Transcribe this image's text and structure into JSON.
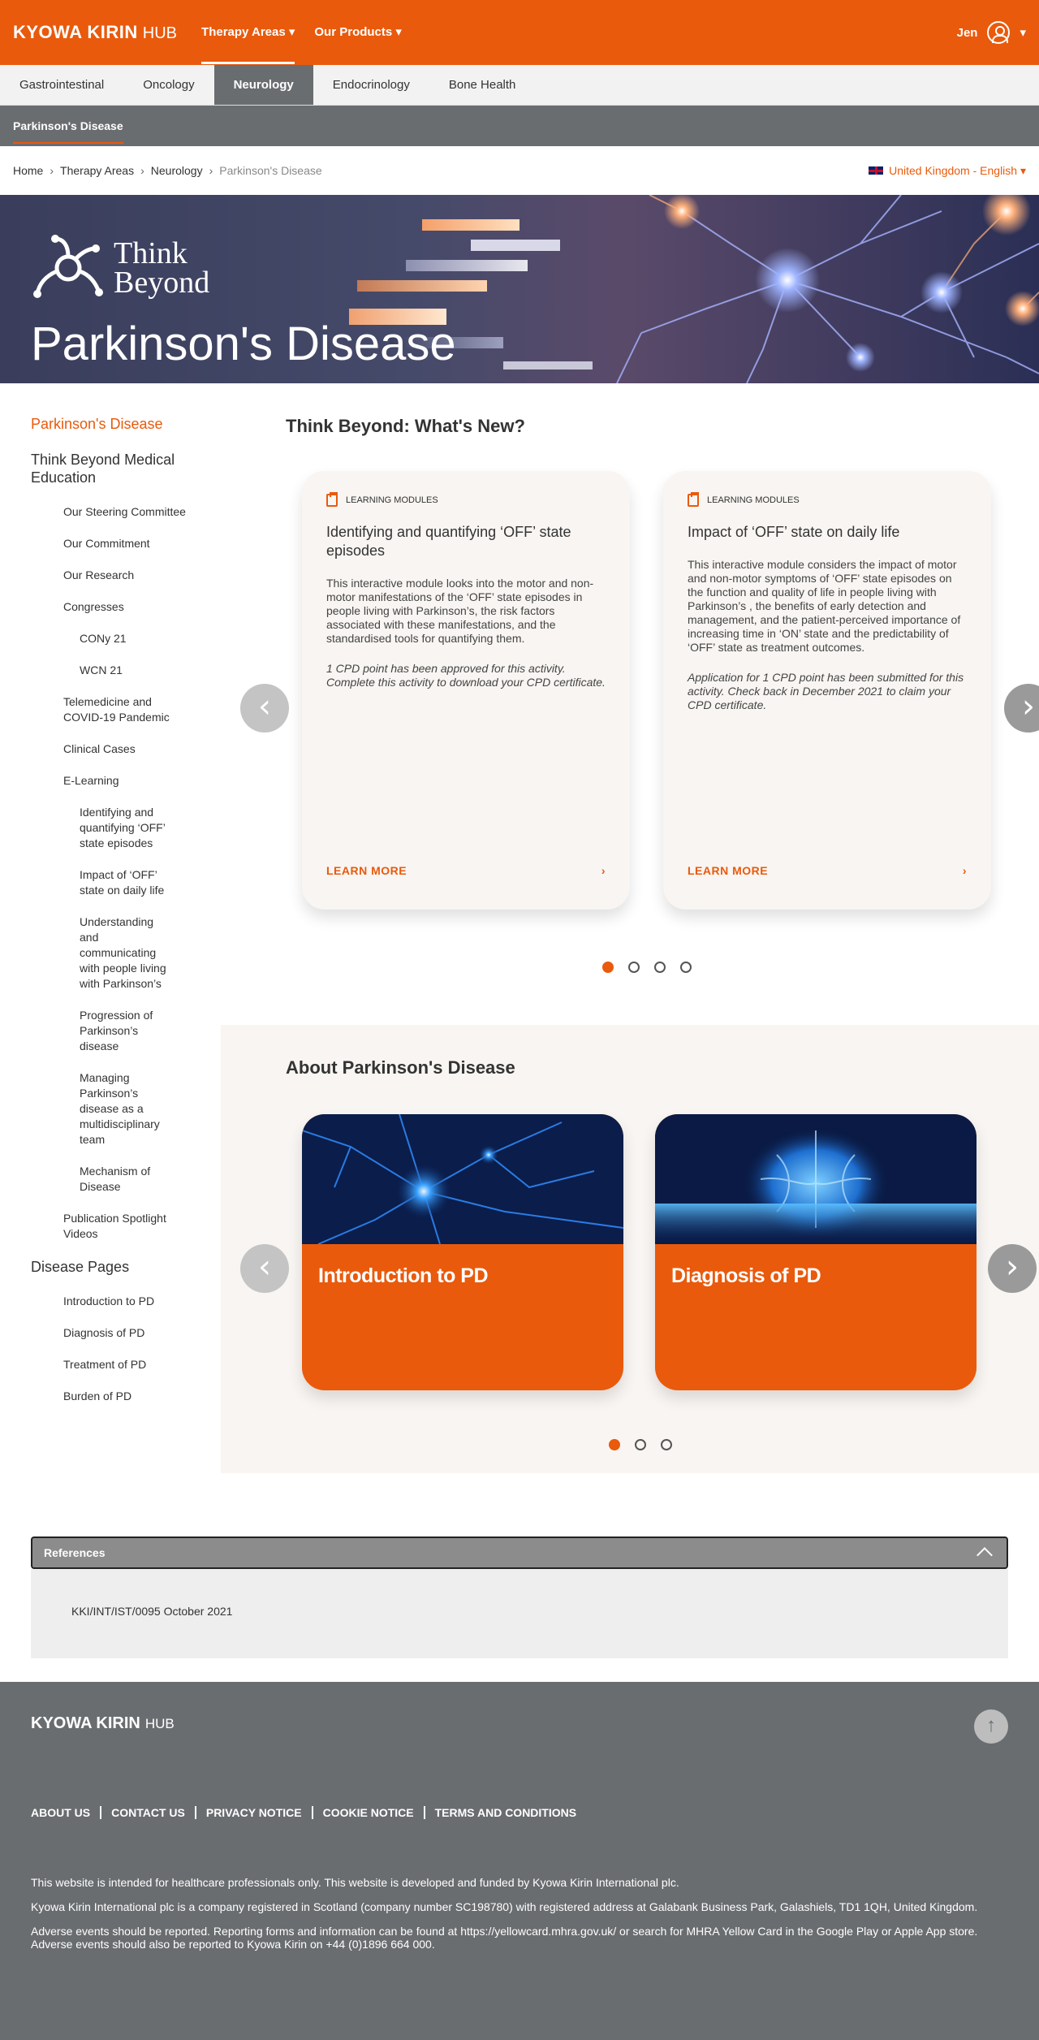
{
  "header": {
    "brand": "KYOWA KIRIN",
    "hub": "HUB",
    "nav": [
      "Therapy Areas ▾",
      "Our Products ▾"
    ],
    "user": "Jen",
    "user_caret": "▾"
  },
  "tabs": [
    "Gastrointestinal",
    "Oncology",
    "Neurology",
    "Endocrinology",
    "Bone Health"
  ],
  "subnav": "Parkinson's Disease",
  "breadcrumb": [
    "Home",
    "Therapy Areas",
    "Neurology",
    "Parkinson's Disease"
  ],
  "breadcrumb_sep": "›",
  "language": "United Kingdom - English ▾",
  "hero": {
    "think_line1": "Think",
    "think_line2": "Beyond",
    "title": "Parkinson's Disease"
  },
  "sidebar": {
    "top": "Parkinson's Disease",
    "heading1": "Think Beyond Medical Education",
    "items1": [
      "Our Steering Committee",
      "Our Commitment",
      "Our Research",
      "Congresses"
    ],
    "congresses": [
      "CONy 21",
      "WCN 21"
    ],
    "items2": [
      "Telemedicine and COVID-19 Pandemic",
      "Clinical Cases",
      "E-Learning"
    ],
    "elearning": [
      "Identifying and quantifying ‘OFF’ state episodes",
      "Impact of ‘OFF’ state on daily life",
      "Understanding and communicating with people living with Parkinson’s",
      "Progression of Parkinson’s disease",
      "Managing Parkinson’s disease as a multidisciplinary team",
      "Mechanism of Disease"
    ],
    "items3": [
      "Publication Spotlight Videos"
    ],
    "heading2": "Disease Pages",
    "disease_pages": [
      "Introduction to PD",
      "Diagnosis of PD",
      "Treatment of PD",
      "Burden of PD"
    ]
  },
  "whats_new": {
    "title": "Think Beyond: What's New?",
    "cards": [
      {
        "tag": "LEARNING MODULES",
        "title": "Identifying and quantifying ‘OFF’ state episodes",
        "body": "This interactive module looks into the motor and non-motor manifestations of the ‘OFF’ state episodes in people living with Parkinson’s, the risk factors associated with these manifestations, and the standardised tools for quantifying them.",
        "note": "1 CPD point has been approved for this activity. Complete this activity to download your CPD certificate.",
        "cta": "LEARN MORE"
      },
      {
        "tag": "LEARNING MODULES",
        "title": "Impact of ‘OFF’ state on daily life",
        "body": "This interactive module considers the impact of motor and non-motor symptoms of ‘OFF’ state episodes on the function and quality of life in people living with Parkinson’s , the benefits of early detection and management, and the patient-perceived importance of increasing time in ‘ON’ state and the predictability of ‘OFF’ state as treatment outcomes.",
        "note": "Application for 1 CPD point has been submitted for this activity. Check back in December 2021 to claim your CPD certificate.",
        "cta": "LEARN MORE"
      }
    ],
    "prev": "‹",
    "next": "›",
    "chevron": "›"
  },
  "about": {
    "title": "About Parkinson's Disease",
    "cards": [
      "Introduction to PD",
      "Diagnosis of PD"
    ],
    "prev": "‹",
    "next": "›"
  },
  "references": {
    "title": "References",
    "body": "KKI/INT/IST/0095 October 2021"
  },
  "footer": {
    "brand": "KYOWA KIRIN",
    "hub": "HUB",
    "up": "↑",
    "links": [
      "ABOUT US",
      "CONTACT US",
      "PRIVACY NOTICE",
      "COOKIE NOTICE",
      "TERMS AND CONDITIONS"
    ],
    "notes": [
      "This website is intended for healthcare professionals only. This website is developed and funded by Kyowa Kirin International plc.",
      "Kyowa Kirin International plc is a company registered in Scotland (company number SC198780) with registered address at Galabank Business Park, Galashiels, TD1 1QH, United Kingdom.",
      "Adverse events should be reported. Reporting forms and information can be found at https://yellowcard.mhra.gov.uk/ or search for MHRA Yellow Card in the Google Play or Apple App store.",
      "Adverse events should also be reported to Kyowa Kirin on +44 (0)1896 664 000."
    ]
  },
  "colors": {
    "accent": "#e95a0c",
    "grey_bar": "#6a6d70",
    "card_bg": "#f8f5f2"
  },
  "carousels": {
    "whats_new_slides": 4,
    "whats_new_active": 1,
    "about_slides": 3,
    "about_active": 1
  }
}
